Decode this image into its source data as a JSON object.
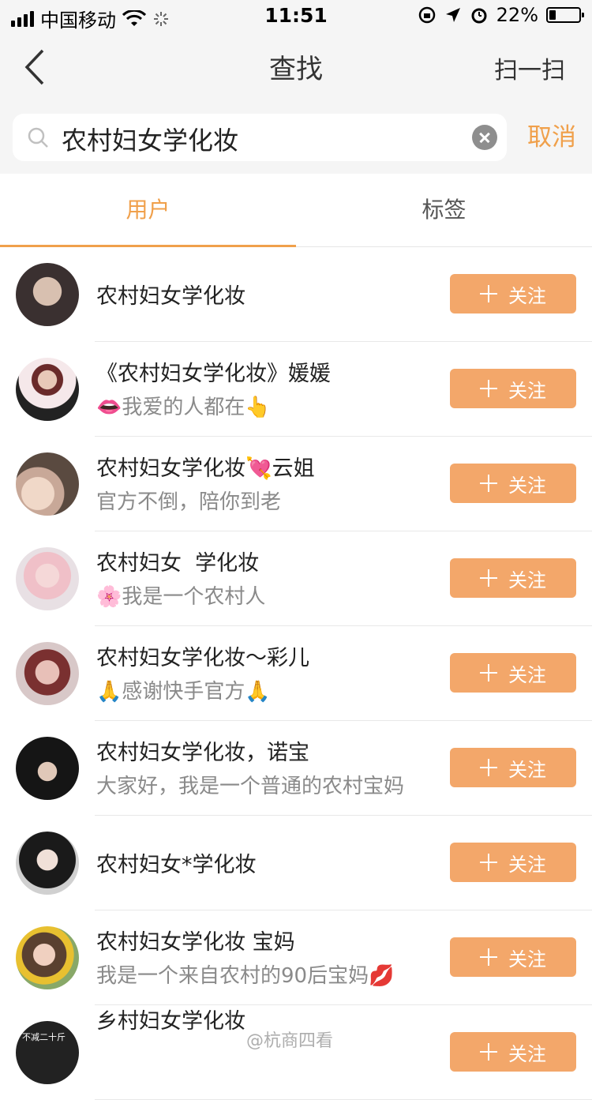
{
  "status_bar": {
    "carrier": "中国移动",
    "time": "11:51",
    "battery": "22%",
    "battery_level": 0.22
  },
  "nav": {
    "title": "查找",
    "scan_label": "扫一扫",
    "back_icon": "chevron-left-icon"
  },
  "search": {
    "query": "农村妇女学化妆",
    "cancel_label": "取消"
  },
  "tabs": [
    {
      "label": "用户",
      "active": true
    },
    {
      "label": "标签",
      "active": false
    }
  ],
  "follow_label": "关注",
  "users": [
    {
      "name": "农村妇女学化妆",
      "desc": ""
    },
    {
      "name": "《农村妇女学化妆》媛媛",
      "desc": "👄我爱的人都在👆"
    },
    {
      "name": "农村妇女学化妆💘云姐",
      "desc": "官方不倒，陪你到老"
    },
    {
      "name": "农村妇女  学化妆",
      "desc": "🌸我是一个农村人"
    },
    {
      "name": "农村妇女学化妆～彩儿",
      "desc": "🙏感谢快手官方🙏"
    },
    {
      "name": "农村妇女学化妆，诺宝",
      "desc": "大家好，我是一个普通的农村宝妈"
    },
    {
      "name": "农村妇女*学化妆",
      "desc": ""
    },
    {
      "name": "农村妇女学化妆 宝妈",
      "desc": "我是一个来自农村的90后宝妈💋"
    },
    {
      "name": "乡村妇女学化妆",
      "desc": ""
    }
  ],
  "avatar_badge_text": "不减二十斤",
  "watermark": "@杭商四看",
  "colors": {
    "accent": "#f0a04b",
    "button": "#f3a76a"
  }
}
